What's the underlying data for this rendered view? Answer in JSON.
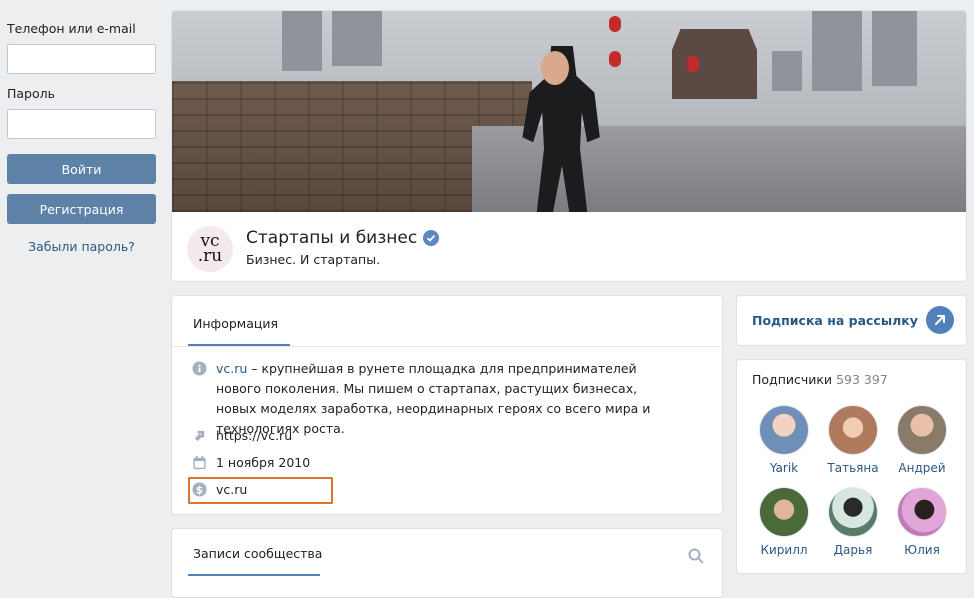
{
  "login": {
    "phone_label": "Телефон или e-mail",
    "password_label": "Пароль",
    "phone_value": "",
    "password_value": "",
    "login_button": "Войти",
    "register_button": "Регистрация",
    "forgot_link": "Забыли пароль?"
  },
  "group": {
    "logo_top": "vc",
    "logo_bottom": ".ru",
    "title": "Стартапы и бизнес",
    "status": "Бизнес. И стартапы.",
    "verified_icon": "verified-check-icon"
  },
  "info": {
    "tab_label": "Информация",
    "description_link": "vc.ru",
    "description_text": " – крупнейшая в рунете площадка для предпринимателей нового поколения. Мы пишем о стартапах, растущих бизнесах, новых моделях заработка, неординарных героях со всего мира и технологиях роста.",
    "website": "https://vc.ru",
    "founded": "1 ноября 2010",
    "money_link": "vc.ru"
  },
  "posts": {
    "tab_label": "Записи сообщества"
  },
  "subscribe": {
    "label": "Подписка на рассылку"
  },
  "members": {
    "title": "Подписчики",
    "count": "593 397",
    "list": [
      {
        "name": "Yarik",
        "color": "#6f8fb8"
      },
      {
        "name": "Татьяна",
        "color": "#b07a5e"
      },
      {
        "name": "Андрей",
        "color": "#8a7a6a"
      },
      {
        "name": "Кирилл",
        "color": "#4a6a3a"
      },
      {
        "name": "Дарья",
        "color": "#5a7a6a"
      },
      {
        "name": "Юлия",
        "color": "#c07ab8"
      }
    ]
  },
  "colors": {
    "accent": "#5181b8",
    "button": "#5e81a8",
    "link": "#2a5885",
    "highlight": "#d9772e",
    "background": "#edeef0"
  }
}
